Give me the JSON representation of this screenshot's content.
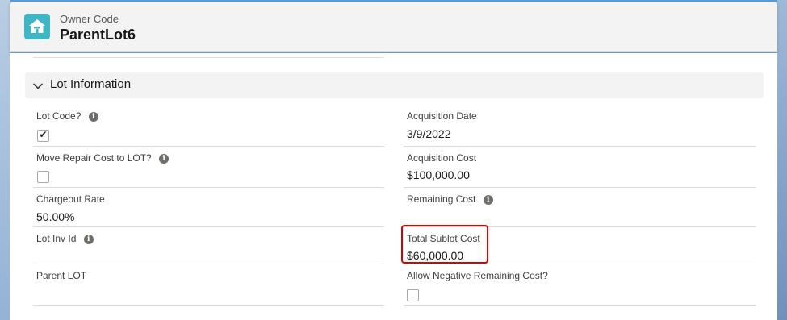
{
  "header": {
    "object_label": "Owner Code",
    "record_title": "ParentLot6",
    "icon": "house-icon"
  },
  "section": {
    "title": "Lot Information",
    "icon": "chevron-down-icon"
  },
  "fields_left": [
    {
      "label": "Lot Code?",
      "type": "checkbox",
      "checked": true,
      "info": true
    },
    {
      "label": "Move Repair Cost to LOT?",
      "type": "checkbox",
      "checked": false,
      "info": true
    },
    {
      "label": "Chargeout Rate",
      "value": "50.00%"
    },
    {
      "label": "Lot Inv Id",
      "value": "",
      "info": true
    },
    {
      "label": "Parent LOT",
      "value": ""
    }
  ],
  "fields_right": [
    {
      "label": "Acquisition Date",
      "value": "3/9/2022"
    },
    {
      "label": "Acquisition Cost",
      "value": "$100,000.00"
    },
    {
      "label": "Remaining Cost",
      "value": "",
      "info": true
    },
    {
      "label": "Total Sublot Cost",
      "value": "$60,000.00"
    },
    {
      "label": "Allow Negative Remaining Cost?",
      "type": "checkbox",
      "checked": false
    }
  ],
  "info_glyph": "i",
  "check_glyph": "✔",
  "colors": {
    "header_icon_bg": "#3fb5c6",
    "highlight_border": "#e00000"
  }
}
